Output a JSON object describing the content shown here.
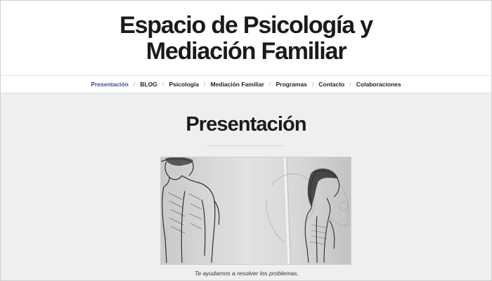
{
  "site": {
    "title": "Espacio de Psicología y Mediación Familiar"
  },
  "nav": {
    "items": [
      {
        "label": "Presentación",
        "active": true
      },
      {
        "label": "BLOG"
      },
      {
        "label": "Psicología"
      },
      {
        "label": "Mediación Familiar"
      },
      {
        "label": "Programas"
      },
      {
        "label": "Contacto"
      },
      {
        "label": "Colaboraciones"
      }
    ],
    "separator": "/",
    "active_color": "#3d4a8f"
  },
  "page": {
    "title": "Presentación"
  },
  "figure": {
    "description_icon": "sketch-man-woman-image",
    "caption": "Te ayudamos a resolver los problemas."
  }
}
